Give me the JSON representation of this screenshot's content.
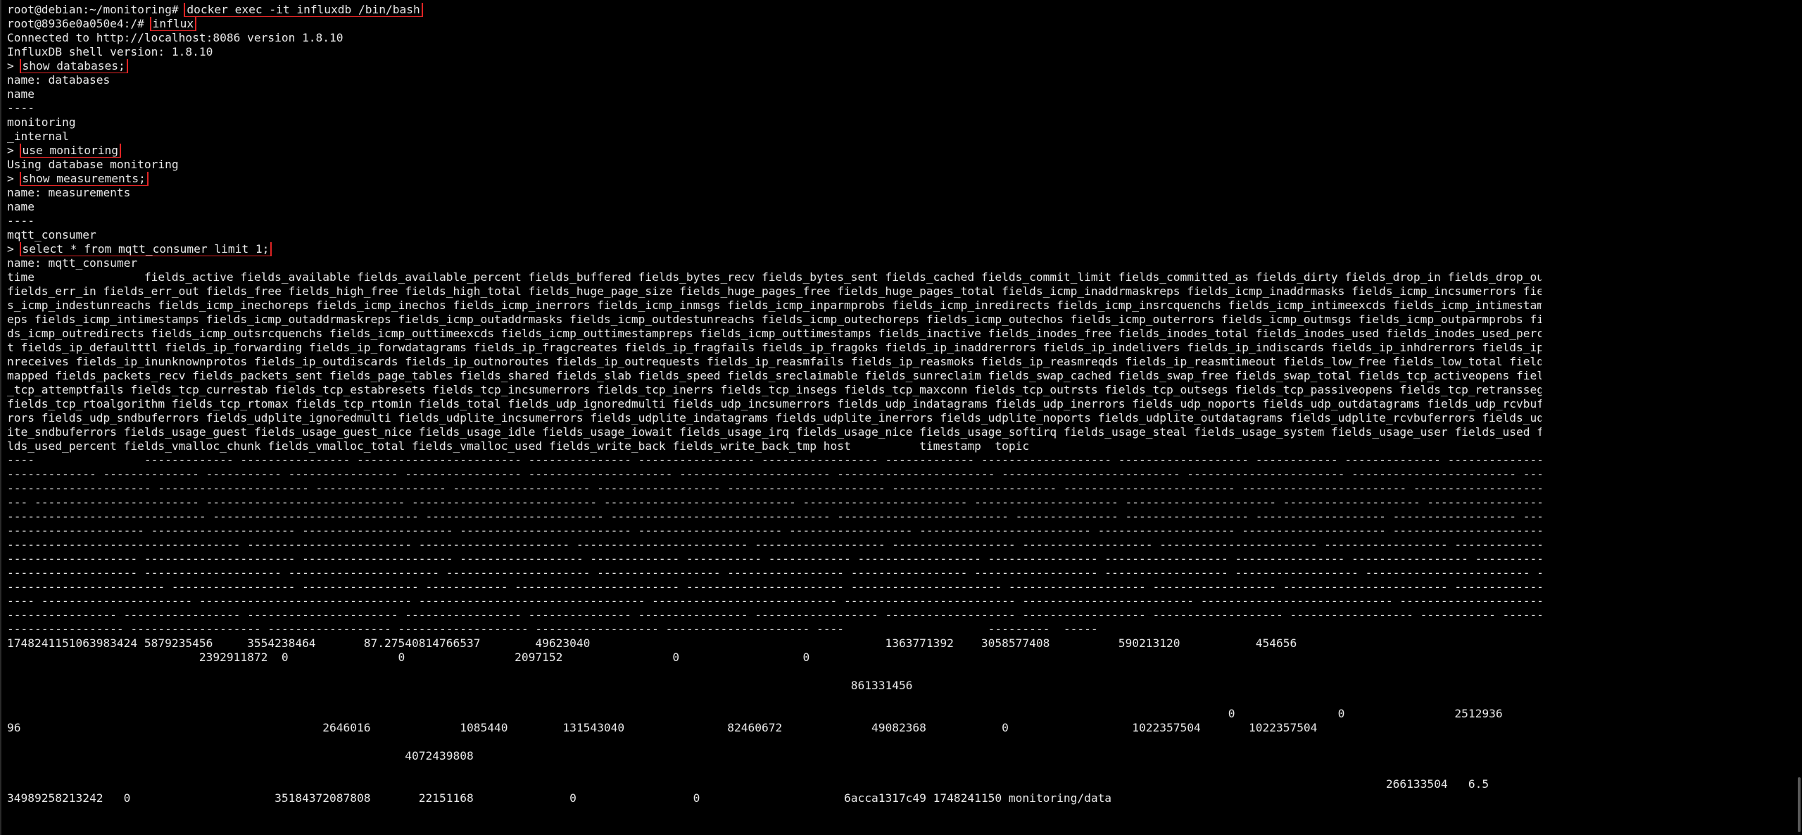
{
  "terminal": {
    "lines": [
      {
        "prompt": "root@debian:~/monitoring# ",
        "command": "docker exec -it influxdb /bin/bash"
      },
      {
        "prompt": "root@8936e0a050e4:/# ",
        "command": "influx"
      },
      {
        "text": "Connected to http://localhost:8086 version 1.8.10"
      },
      {
        "text": "InfluxDB shell version: 1.8.10"
      },
      {
        "prompt": "> ",
        "command": "show databases;"
      },
      {
        "text": "name: databases"
      },
      {
        "text": "name"
      },
      {
        "text": "----"
      },
      {
        "text": "monitoring"
      },
      {
        "text": "_internal"
      },
      {
        "prompt": "> ",
        "command": "use monitoring"
      },
      {
        "text": "Using database monitoring"
      },
      {
        "prompt": "> ",
        "command": "show measurements;"
      },
      {
        "text": "name: measurements"
      },
      {
        "text": "name"
      },
      {
        "text": "----"
      },
      {
        "text": "mqtt_consumer"
      },
      {
        "prompt": "> ",
        "command": "select * from mqtt_consumer limit 1;"
      },
      {
        "text": "name: mqtt_consumer"
      },
      {
        "text": "time                fields_active fields_available fields_available_percent fields_buffered fields_bytes_recv fields_bytes_sent fields_cached fields_commit_limit fields_committed_as fields_dirty fields_drop_in fields_drop_out"
      },
      {
        "text": "fields_err_in fields_err_out fields_free fields_high_free fields_high_total fields_huge_page_size fields_huge_pages_free fields_huge_pages_total fields_icmp_inaddrmaskreps fields_icmp_inaddrmasks fields_icmp_incsumerrors field"
      },
      {
        "text": "s_icmp_indestunreachs fields_icmp_inechoreps fields_icmp_inechos fields_icmp_inerrors fields_icmp_inmsgs fields_icmp_inparmprobs fields_icmp_inredirects fields_icmp_insrcquenchs fields_icmp_intimeexcds fields_icmp_intimestampr"
      },
      {
        "text": "eps fields_icmp_intimestamps fields_icmp_outaddrmaskreps fields_icmp_outaddrmasks fields_icmp_outdestunreachs fields_icmp_outechoreps fields_icmp_outechos fields_icmp_outerrors fields_icmp_outmsgs fields_icmp_outparmprobs fiel"
      },
      {
        "text": "ds_icmp_outredirects fields_icmp_outsrcquenchs fields_icmp_outtimeexcds fields_icmp_outtimestampreps fields_icmp_outtimestamps fields_inactive fields_inodes_free fields_inodes_total fields_inodes_used fields_inodes_used_percen"
      },
      {
        "text": "t fields_ip_defaultttl fields_ip_forwarding fields_ip_forwdatagrams fields_ip_fragcreates fields_ip_fragfails fields_ip_fragoks fields_ip_inaddrerrors fields_ip_indelivers fields_ip_indiscards fields_ip_inhdrerrors fields_ip_i"
      },
      {
        "text": "nreceives fields_ip_inunknownprotos fields_ip_outdiscards fields_ip_outnoroutes fields_ip_outrequests fields_ip_reasmfails fields_ip_reasmoks fields_ip_reasmreqds fields_ip_reasmtimeout fields_low_free fields_low_total fields_"
      },
      {
        "text": "mapped fields_packets_recv fields_packets_sent fields_page_tables fields_shared fields_slab fields_speed fields_sreclaimable fields_sunreclaim fields_swap_cached fields_swap_free fields_swap_total fields_tcp_activeopens fields"
      },
      {
        "text": "_tcp_attemptfails fields_tcp_currestab fields_tcp_estabresets fields_tcp_incsumerrors fields_tcp_inerrs fields_tcp_insegs fields_tcp_maxconn fields_tcp_outrsts fields_tcp_outsegs fields_tcp_passiveopens fields_tcp_retranssegs"
      },
      {
        "text": "fields_tcp_rtoalgorithm fields_tcp_rtomax fields_tcp_rtomin fields_total fields_udp_ignoredmulti fields_udp_incsumerrors fields_udp_indatagrams fields_udp_inerrors fields_udp_noports fields_udp_outdatagrams fields_udp_rcvbufer"
      },
      {
        "text": "rors fields_udp_sndbuferrors fields_udplite_ignoredmulti fields_udplite_incsumerrors fields_udplite_indatagrams fields_udplite_inerrors fields_udplite_noports fields_udplite_outdatagrams fields_udplite_rcvbuferrors fields_udpl"
      },
      {
        "text": "ite_sndbuferrors fields_usage_guest fields_usage_guest_nice fields_usage_idle fields_usage_iowait fields_usage_irq fields_usage_nice fields_usage_softirq fields_usage_steal fields_usage_system fields_usage_user fields_used fie"
      },
      {
        "text": "lds_used_percent fields_vmalloc_chunk fields_vmalloc_total fields_vmalloc_used fields_write_back fields_write_back_tmp host          timestamp  topic"
      },
      {
        "text": "----                ------------- ---------------- ------------------------ --------------- ----------------- ----------------- ------------- ------------------- ------------------- ------------ -------------- ---------------"
      },
      {
        "text": "------------- -------------- ----------- ---------------- ----------------- --------------------- ---------------------- ----------------------- -------------------------- ----------------------- ------------------------ -----"
      },
      {
        "text": "--------------------- ---------------------- ------------------- -------------------- ------------------ ----------------------- ------------------------ ------------------------- ------------------------ ------------------------"
      },
      {
        "text": "--- ------------------------ ----------------------------- --------------------------- ---------------------------- ------------------------ --------------------- ---------------------- -------------------- ----------------------- ----"
      },
      {
        "text": "----------------------------- ------------------------------ -------------------------- -------------------------------- ------------------------- --------------- ------------------ ------------------- ------------------ -------------"
      },
      {
        "text": "-------------------- --------------------- ---------------------- ------------------------- --------------------- ------------------ ------------------------- -------------------- --------------------- ----------------------- ------"
      },
      {
        "text": "---------------------------------- ------------------------ ---------------------- ------------------------- ------------------- ------------------ ------------------- ----------------------- ------------------ ---------------- ------"
      },
      {
        "text": "------------------- ---------------------- ---------------------- ------------------ ------------- ----------- ------------ ------------------ ---------------- ------------------ ---------------- ----------------- ---------------------"
      },
      {
        "text": "------------------- -------------------- ---------------------- --------------------- ------------------ ----------------- ----------------- ------------------ ------------------ ------------------ ------------------------ -----------"
      },
      {
        "text": "----------------------- ------------------ ----------------- ------------ ------------------------ ----------------------- ---------------------- -------------------- ------------------ ------------------------ ---------------------"
      },
      {
        "text": "---- ---------------------- ------------------------------- --------------------------------- --------------------------- ------------------------- ------------------------- ---------------------------- ----------------------- ----"
      },
      {
        "text": "---------------- ----------------- ---------------------- ----------------- --------------- ---------------- ------------------ ------------------- ------------------ ------------------- ------------------ ----------- ------------ ---"
      },
      {
        "text": "----------------- ------------------- ------------------ ------------------- ------------------ --------------------- ----                     ---------  -----"
      },
      {
        "text": "1748241151063983424 5879235456     3554238464       87.27540814766537        49623040                                           1363771392    3058577408          590213120           454656"
      },
      {
        "text": "                            2392911872  0                0                2097152                0                  0"
      },
      {
        "text": ""
      },
      {
        "text": "                                                                                                                           861331456"
      },
      {
        "text": ""
      },
      {
        "text": "                                                                                                                                                                                  0               0                2512936"
      },
      {
        "text": "96                                            2646016             1085440        131543040               82460672             49082368           0                  1022357504       1022357504"
      },
      {
        "text": ""
      },
      {
        "text": "                                                          4072439808"
      },
      {
        "text": ""
      },
      {
        "text": "                                                                                                                                                                                                         266133504   6.5"
      },
      {
        "text": "34989258213242   0                     35184372087808       22151168              0                 0                     6acca1317c49 1748241150 monitoring/data"
      }
    ]
  }
}
